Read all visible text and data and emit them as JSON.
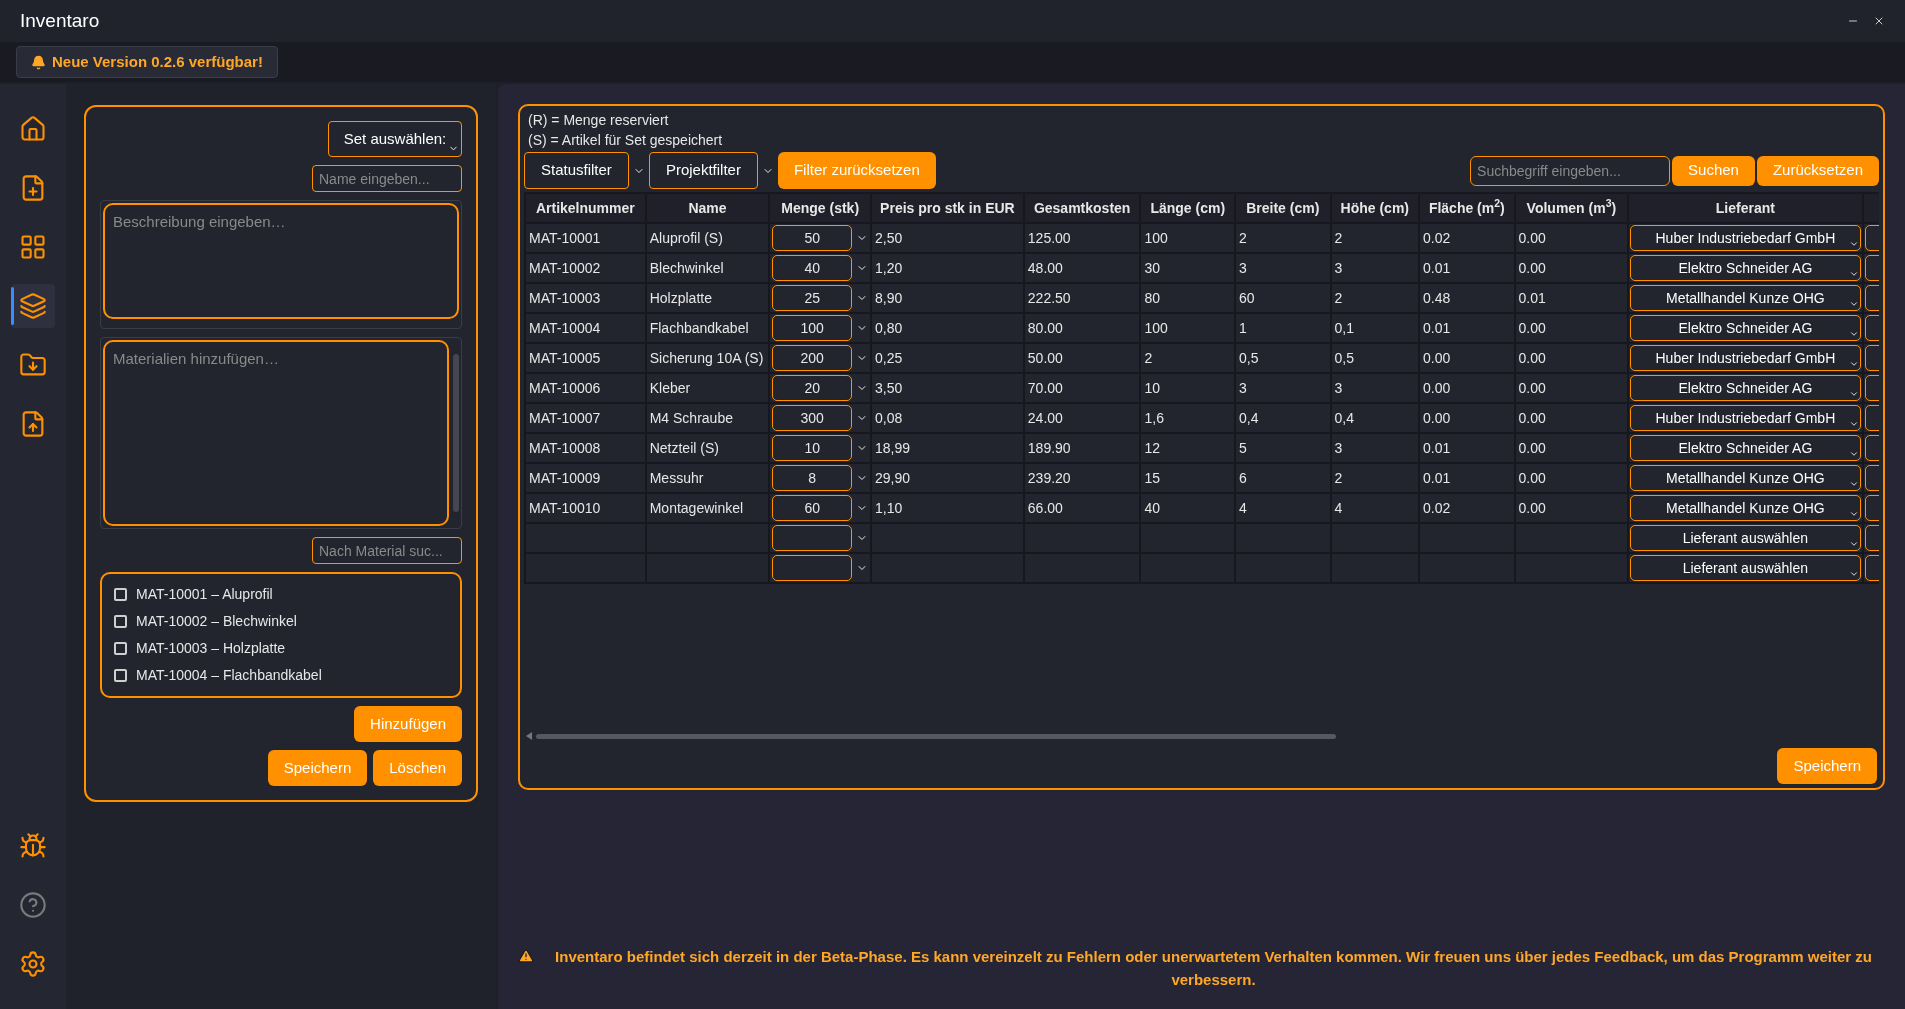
{
  "window": {
    "title": "Inventaro"
  },
  "update_banner": {
    "text": "Neue Version 0.2.6 verfügbar!"
  },
  "sidebar": {
    "items": [
      {
        "kind": "home",
        "selected": false
      },
      {
        "kind": "file-plus",
        "selected": false
      },
      {
        "kind": "grid",
        "selected": false
      },
      {
        "kind": "layers",
        "selected": true
      },
      {
        "kind": "download",
        "selected": false
      },
      {
        "kind": "upload",
        "selected": false
      }
    ],
    "bottom_items": [
      {
        "kind": "bug"
      },
      {
        "kind": "help"
      },
      {
        "kind": "settings"
      }
    ]
  },
  "set_editor": {
    "set_select": "Set auswählen:",
    "name_placeholder": "Name eingeben...",
    "description_placeholder": "Beschreibung eingeben…",
    "materials_placeholder": "Materialien hinzufügen…",
    "search_placeholder": "Nach Material suc...",
    "materials": [
      {
        "label": "MAT-10001 – Aluprofil",
        "checked": false
      },
      {
        "label": "MAT-10002 – Blechwinkel",
        "checked": false
      },
      {
        "label": "MAT-10003 – Holzplatte",
        "checked": false
      },
      {
        "label": "MAT-10004 – Flachbandkabel",
        "checked": false
      }
    ],
    "add_button": "Hinzufügen",
    "save_button": "Speichern",
    "delete_button": "Löschen"
  },
  "legend": [
    "(R) = Menge reserviert",
    "(S) = Artikel für Set gespeichert"
  ],
  "filters": {
    "status": "Statusfilter",
    "project": "Projektfilter",
    "reset": "Filter zurücksetzen"
  },
  "search": {
    "placeholder": "Suchbegriff eingeben...",
    "search_button": "Suchen",
    "reset_button": "Zurücksetzen"
  },
  "table": {
    "columns": [
      "Artikelnummer",
      "Name",
      "Menge (stk)",
      "Preis pro stk in EUR",
      "Gesamtkosten",
      "Länge (cm)",
      "Breite (cm)",
      "Höhe (cm)",
      "Fläche (m$^{2}$)",
      "Volumen (m$^{3}$)",
      "Lieferant"
    ],
    "rows": [
      {
        "kind": "item",
        "cells": [
          "MAT-10001",
          "Aluprofil (S)",
          "50",
          "2,50",
          "125.00",
          "100",
          "2",
          "2",
          "0.02",
          "0.00",
          "Huber Industriebedarf GmbH"
        ]
      },
      {
        "kind": "item",
        "cells": [
          "MAT-10002",
          "Blechwinkel",
          "40",
          "1,20",
          "48.00",
          "30",
          "3",
          "3",
          "0.01",
          "0.00",
          "Elektro Schneider AG"
        ]
      },
      {
        "kind": "item",
        "cells": [
          "MAT-10003",
          "Holzplatte",
          "25",
          "8,90",
          "222.50",
          "80",
          "60",
          "2",
          "0.48",
          "0.01",
          "Metallhandel Kunze OHG"
        ]
      },
      {
        "kind": "item",
        "cells": [
          "MAT-10004",
          "Flachbandkabel",
          "100",
          "0,80",
          "80.00",
          "100",
          "1",
          "0,1",
          "0.01",
          "0.00",
          "Elektro Schneider AG"
        ]
      },
      {
        "kind": "item",
        "cells": [
          "MAT-10005",
          "Sicherung 10A (S)",
          "200",
          "0,25",
          "50.00",
          "2",
          "0,5",
          "0,5",
          "0.00",
          "0.00",
          "Huber Industriebedarf GmbH"
        ]
      },
      {
        "kind": "item",
        "cells": [
          "MAT-10006",
          "Kleber",
          "20",
          "3,50",
          "70.00",
          "10",
          "3",
          "3",
          "0.00",
          "0.00",
          "Elektro Schneider AG"
        ]
      },
      {
        "kind": "item",
        "cells": [
          "MAT-10007",
          "M4 Schraube",
          "300",
          "0,08",
          "24.00",
          "1,6",
          "0,4",
          "0,4",
          "0.00",
          "0.00",
          "Huber Industriebedarf GmbH"
        ]
      },
      {
        "kind": "item",
        "cells": [
          "MAT-10008",
          "Netzteil (S)",
          "10",
          "18,99",
          "189.90",
          "12",
          "5",
          "3",
          "0.01",
          "0.00",
          "Elektro Schneider AG"
        ]
      },
      {
        "kind": "item",
        "cells": [
          "MAT-10009",
          "Messuhr",
          "8",
          "29,90",
          "239.20",
          "15",
          "6",
          "2",
          "0.01",
          "0.00",
          "Metallhandel Kunze OHG"
        ]
      },
      {
        "kind": "item",
        "cells": [
          "MAT-10010",
          "Montagewinkel",
          "60",
          "1,10",
          "66.00",
          "40",
          "4",
          "4",
          "0.02",
          "0.00",
          "Metallhandel Kunze OHG"
        ]
      },
      {
        "kind": "blank",
        "supplier_placeholder": "Lieferant auswählen"
      },
      {
        "kind": "blank",
        "supplier_placeholder": "Lieferant auswählen"
      }
    ]
  },
  "save_button": "Speichern",
  "beta_notice": "Inventaro befindet sich derzeit in der Beta-Phase. Es kann vereinzelt zu Fehlern oder unerwartetem Verhalten kommen. Wir freuen uns über jedes Feedback, um das Programm weiter zu verbessern."
}
